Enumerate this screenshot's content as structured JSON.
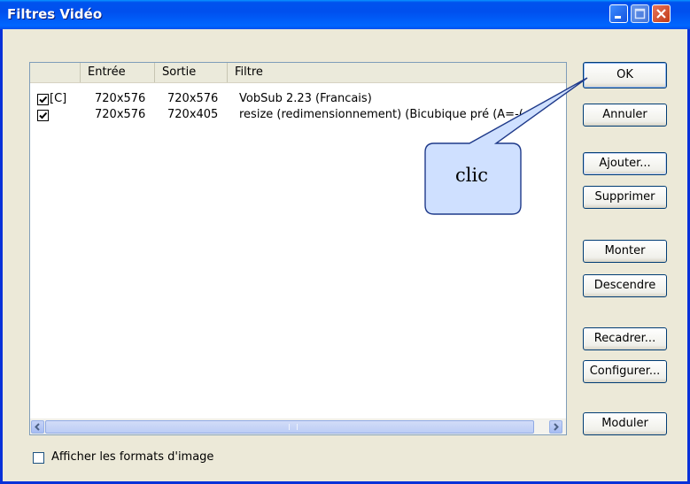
{
  "window": {
    "title": "Filtres Vidéo"
  },
  "list": {
    "headers": [
      "",
      "Entrée",
      "Sortie",
      "Filtre"
    ],
    "rows": [
      {
        "checked": true,
        "tag": "[C]",
        "entree": "720x576",
        "sortie": "720x576",
        "filtre": "VobSub 2.23 (Francais)"
      },
      {
        "checked": true,
        "tag": "",
        "entree": "720x576",
        "sortie": "720x405",
        "filtre": "resize (redimensionnement) (Bicubique pré     (A=-("
      }
    ],
    "scroll_grip": "III"
  },
  "buttons": {
    "ok": "OK",
    "annuler": "Annuler",
    "ajouter": "Ajouter...",
    "supprimer": "Supprimer",
    "monter": "Monter",
    "descendre": "Descendre",
    "recadrer": "Recadrer...",
    "configurer": "Configurer...",
    "moduler": "Moduler"
  },
  "options": {
    "afficher_formats": "Afficher les formats d'image",
    "afficher_formats_checked": false
  },
  "annotation": {
    "text": "clic",
    "color": "#cfe0ff"
  },
  "colors": {
    "titlebar": "#0053ee",
    "dialog_bg": "#ece9d8",
    "button_border": "#003c74"
  }
}
